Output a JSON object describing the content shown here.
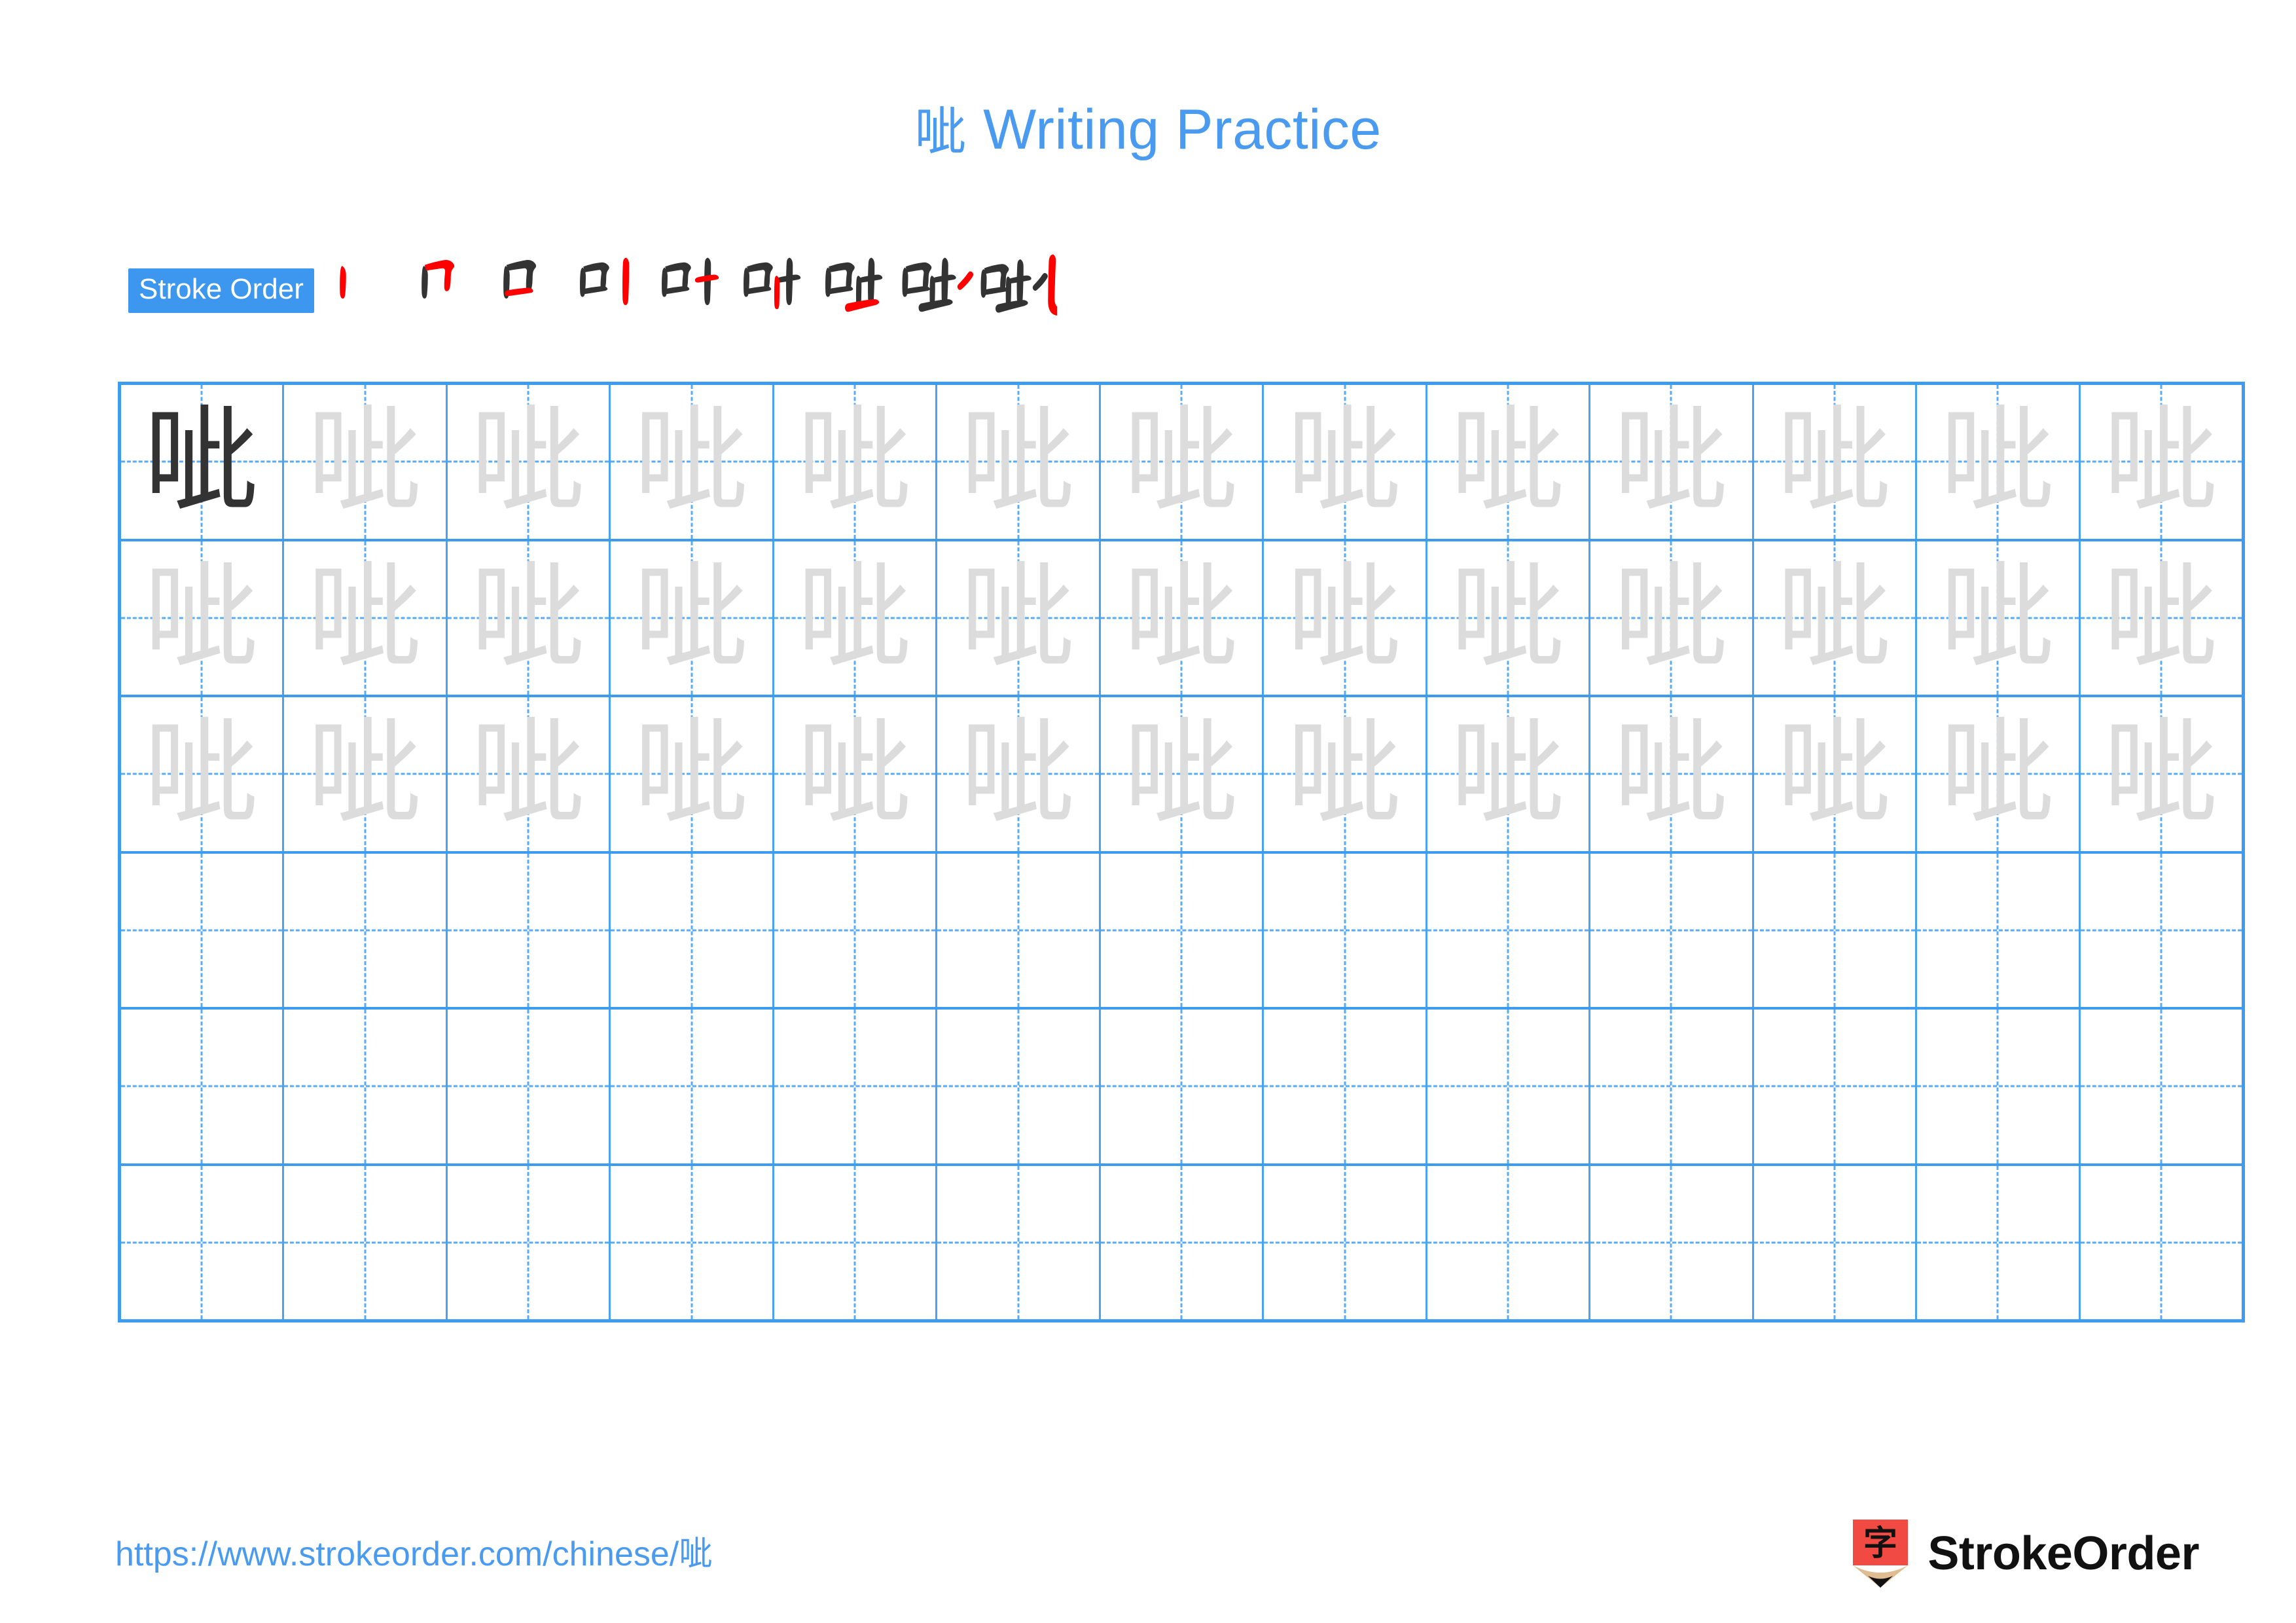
{
  "character": "呲",
  "title": {
    "character": "呲",
    "text": " Writing Practice",
    "full": "呲 Writing Practice",
    "color": "#4a9bf0"
  },
  "stroke_order": {
    "label": "Stroke Order",
    "badge_bg": "#3d97ef",
    "badge_text_color": "#ffffff",
    "total_strokes": 9,
    "new_stroke_color": "#ff0000",
    "done_stroke_color": "#333333",
    "steps": [
      {
        "index": 1,
        "name": "stroke-step-1"
      },
      {
        "index": 2,
        "name": "stroke-step-2"
      },
      {
        "index": 3,
        "name": "stroke-step-3"
      },
      {
        "index": 4,
        "name": "stroke-step-4"
      },
      {
        "index": 5,
        "name": "stroke-step-5"
      },
      {
        "index": 6,
        "name": "stroke-step-6"
      },
      {
        "index": 7,
        "name": "stroke-step-7"
      },
      {
        "index": 8,
        "name": "stroke-step-8"
      },
      {
        "index": 9,
        "name": "stroke-step-9"
      }
    ]
  },
  "grid": {
    "columns": 13,
    "rows": 6,
    "border_color": "#3d9bf0",
    "guide_color": "#5aabf4",
    "solid_char_color": "#333333",
    "trace_char_color": "#dcdcdc",
    "row_modes": [
      "first-solid-rest-trace",
      "all-trace",
      "all-trace",
      "blank",
      "blank",
      "blank"
    ]
  },
  "footer": {
    "url_prefix": "https://www.strokeorder.com/chinese/",
    "url_character": "呲",
    "url": "https://www.strokeorder.com/chinese/呲",
    "url_color": "#4a9bf0",
    "brand_name": "StrokeOrder",
    "logo_character": "字",
    "logo_body_color": "#f04a42",
    "logo_tip_color": "#e0bc92",
    "logo_point_color": "#111111"
  }
}
